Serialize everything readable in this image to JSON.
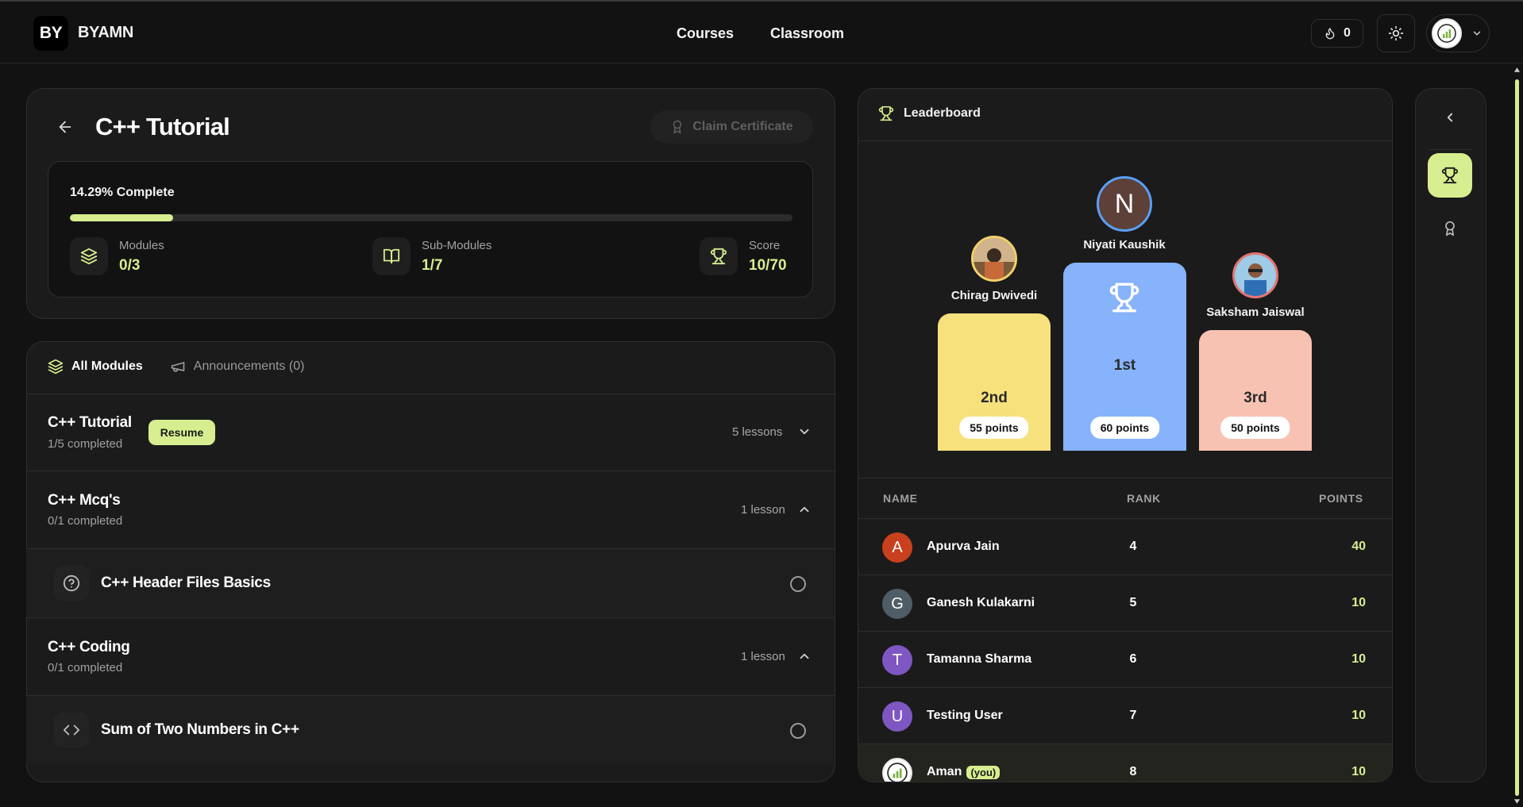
{
  "brand": {
    "logo": "BY",
    "name": "BYAMN"
  },
  "nav": {
    "links": [
      "Courses",
      "Classroom"
    ],
    "streak_count": "0"
  },
  "course": {
    "title": "C++ Tutorial",
    "claim_label": "Claim Certificate",
    "progress_label": "14.29% Complete",
    "progress_percent": 14.29,
    "stats": [
      {
        "icon": "layers-icon",
        "label": "Modules",
        "value": "0/3"
      },
      {
        "icon": "book-open-icon",
        "label": "Sub-Modules",
        "value": "1/7"
      },
      {
        "icon": "trophy-icon",
        "label": "Score",
        "value": "10/70"
      }
    ]
  },
  "tabs": {
    "all_modules": "All Modules",
    "announcements": "Announcements (0)"
  },
  "modules": [
    {
      "title": "C++ Tutorial",
      "sub": "1/5 completed",
      "count": "5 lessons",
      "resume_label": "Resume",
      "expanded": false
    },
    {
      "title": "C++ Mcq's",
      "sub": "0/1 completed",
      "count": "1 lesson",
      "expanded": true,
      "lesson": {
        "icon": "question-circle-icon",
        "name": "C++ Header Files Basics"
      }
    },
    {
      "title": "C++ Coding",
      "sub": "0/1 completed",
      "count": "1 lesson",
      "expanded": true,
      "lesson": {
        "icon": "code-icon",
        "name": "Sum of Two Numbers in C++"
      }
    }
  ],
  "leaderboard": {
    "title": "Leaderboard",
    "podium": [
      {
        "place": "2nd",
        "name": "Chirag Dwivedi",
        "points": "55 points",
        "color": "#f7e17d"
      },
      {
        "place": "1st",
        "name": "Niyati Kaushik",
        "initial": "N",
        "points": "60 points",
        "color": "#86b3fb"
      },
      {
        "place": "3rd",
        "name": "Saksham Jaiswal",
        "points": "50 points",
        "color": "#f8c2b3"
      }
    ],
    "columns": {
      "name": "NAME",
      "rank": "RANK",
      "points": "POINTS"
    },
    "rows": [
      {
        "initial": "A",
        "name": "Apurva Jain",
        "rank": "4",
        "points": "40",
        "color": "#c8401e"
      },
      {
        "initial": "G",
        "name": "Ganesh Kulakarni",
        "rank": "5",
        "points": "10",
        "color": "#4f5e66"
      },
      {
        "initial": "T",
        "name": "Tamanna Sharma",
        "rank": "6",
        "points": "10",
        "color": "#7e57c2"
      },
      {
        "initial": "U",
        "name": "Testing User",
        "rank": "7",
        "points": "10",
        "color": "#7e57c2"
      },
      {
        "initial": "",
        "name": "Aman",
        "you": "(you)",
        "rank": "8",
        "points": "10",
        "color": "#ffffff"
      }
    ]
  },
  "colors": {
    "accent": "#d6ee8f",
    "background": "#121212",
    "panel": "#1b1b1b"
  }
}
